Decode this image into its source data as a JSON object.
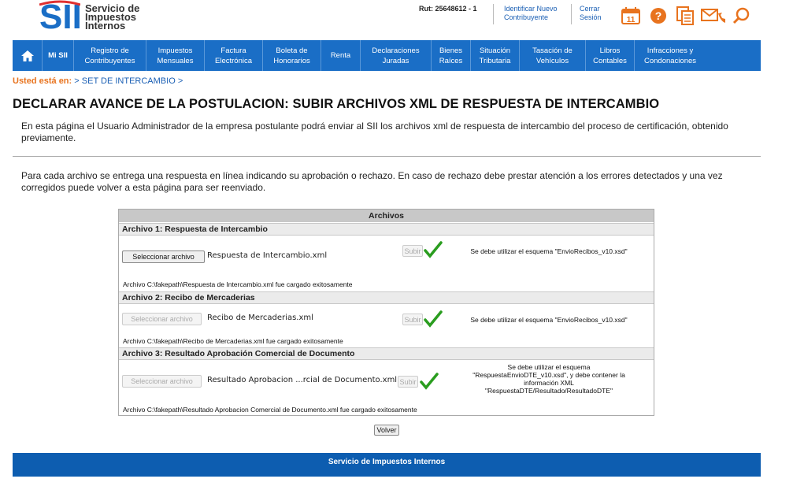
{
  "header": {
    "logo_text": [
      "Servicio de",
      "Impuestos",
      "Internos"
    ],
    "rut": "Rut: 25648612 - 1",
    "identify_link": [
      "Identificar Nuevo",
      "Contribuyente"
    ],
    "logout_link": [
      "Cerrar",
      "Sesión"
    ],
    "calendar_day": "11",
    "icons": [
      "calendar-icon",
      "help-icon",
      "documents-icon",
      "mail-phone-icon",
      "search-icon"
    ]
  },
  "nav": {
    "items": [
      {
        "label": "",
        "icon": "home-icon"
      },
      {
        "label": "Mi SII"
      },
      {
        "label": "Registro de Contribuyentes"
      },
      {
        "label": "Impuestos Mensuales"
      },
      {
        "label": "Factura Electrónica"
      },
      {
        "label": "Boleta de Honorarios"
      },
      {
        "label": "Renta"
      },
      {
        "label": "Declaraciones Juradas"
      },
      {
        "label": "Bienes Raíces"
      },
      {
        "label": "Situación Tributaria"
      },
      {
        "label": "Tasación de Vehículos"
      },
      {
        "label": "Libros Contables"
      },
      {
        "label": "Infracciones y Condonaciones"
      }
    ]
  },
  "breadcrumb": {
    "prefix": "Usted está en:",
    "sep": ">",
    "item": "SET DE INTERCAMBIO"
  },
  "page": {
    "title": "DECLARAR AVANCE DE LA POSTULACION: SUBIR ARCHIVOS XML DE RESPUESTA DE INTERCAMBIO",
    "intro": "En esta página el Usuario Administrador de la empresa postulante podrá enviar al SII los archivos xml de respuesta de intercambio del proceso de certificación, obtenido previamente.",
    "info": "Para cada archivo se entrega una respuesta en línea indicando su aprobación o rechazo. En caso de rechazo debe prestar atención a los errores detectados y una vez corregidos puede volver a esta página para ser reenviado."
  },
  "table": {
    "header": "Archivos",
    "select_label": "Seleccionar archivo",
    "upload_label": "Subir",
    "files": [
      {
        "section": "Archivo 1: Respuesta de Intercambio",
        "file_name": "Respuesta de Intercambio.xml",
        "note": "Se debe utilizar el esquema \"EnvioRecibos_v10.xsd\"",
        "status": "Archivo C:\\fakepath\\Respuesta de Intercambio.xml fue cargado exitosamente"
      },
      {
        "section": "Archivo 2: Recibo de Mercaderias",
        "file_name": "Recibo de Mercaderias.xml",
        "note": "Se debe utilizar el esquema \"EnvioRecibos_v10.xsd\"",
        "status": "Archivo C:\\fakepath\\Recibo de Mercaderias.xml fue cargado exitosamente"
      },
      {
        "section": "Archivo 3: Resultado Aprobación Comercial de Documento",
        "file_name": "Resultado Aprobacion ...rcial de Documento.xml",
        "note": [
          "Se debe utilizar el esquema",
          "\"RespuestaEnvioDTE_v10.xsd\", y debe contener la",
          "información XML",
          "\"RespuestaDTE/Resultado/ResultadoDTE\""
        ],
        "status": "Archivo C:\\fakepath\\Resultado Aprobacion Comercial de Documento.xml fue cargado exitosamente"
      }
    ]
  },
  "back_button": "Volver",
  "footer": "Servicio de Impuestos Internos",
  "colors": {
    "nav": "#1a6ec6",
    "footer": "#0d5db0",
    "accent": "#e8731e",
    "check": "#2a9d1f"
  }
}
